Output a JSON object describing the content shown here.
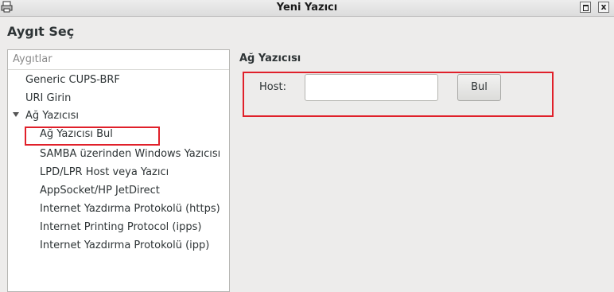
{
  "window": {
    "title": "Yeni Yazıcı",
    "close_glyph": "x"
  },
  "page": {
    "heading": "Aygıt Seç"
  },
  "devices": {
    "header": "Aygıtlar",
    "items": [
      {
        "label": "Generic CUPS-BRF"
      },
      {
        "label": "URI Girin"
      },
      {
        "label": "Ağ Yazıcısı",
        "expanded": true
      },
      {
        "label": "Ağ Yazıcısı Bul",
        "selected": true
      },
      {
        "label": "SAMBA üzerinden Windows Yazıcısı"
      },
      {
        "label": "LPD/LPR Host veya Yazıcı"
      },
      {
        "label": "AppSocket/HP JetDirect"
      },
      {
        "label": "Internet Yazdırma Protokolü (https)"
      },
      {
        "label": "Internet Printing Protocol (ipps)"
      },
      {
        "label": "Internet Yazdırma Protokolü (ipp)"
      }
    ]
  },
  "detail": {
    "section_title": "Ağ Yazıcısı",
    "host_label": "Host:",
    "host_value": "",
    "find_button": "Bul"
  },
  "colors": {
    "highlight": "#e0202a",
    "background": "#edeceb"
  }
}
